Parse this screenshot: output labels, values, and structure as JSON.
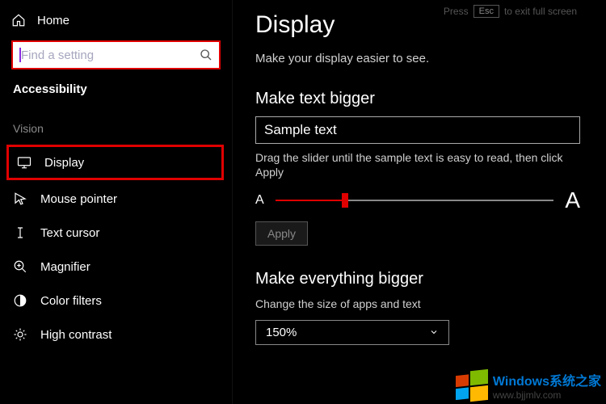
{
  "hint": {
    "press": "Press",
    "esc": "Esc",
    "rest": "to exit full screen"
  },
  "sidebar": {
    "home": "Home",
    "search_placeholder": "Find a setting",
    "section": "Accessibility",
    "group": "Vision",
    "items": [
      {
        "label": "Display"
      },
      {
        "label": "Mouse pointer"
      },
      {
        "label": "Text cursor"
      },
      {
        "label": "Magnifier"
      },
      {
        "label": "Color filters"
      },
      {
        "label": "High contrast"
      }
    ]
  },
  "main": {
    "title": "Display",
    "intro": "Make your display easier to see.",
    "text_bigger": {
      "heading": "Make text bigger",
      "sample": "Sample text",
      "help": "Drag the slider until the sample text is easy to read, then click Apply",
      "small_a": "A",
      "big_a": "A",
      "slider_percent": 25,
      "apply": "Apply"
    },
    "everything_bigger": {
      "heading": "Make everything bigger",
      "help": "Change the size of apps and text",
      "value": "150%"
    }
  },
  "watermark": {
    "line1": "Windows系统之家",
    "line2": "www.bjjmlv.com"
  }
}
